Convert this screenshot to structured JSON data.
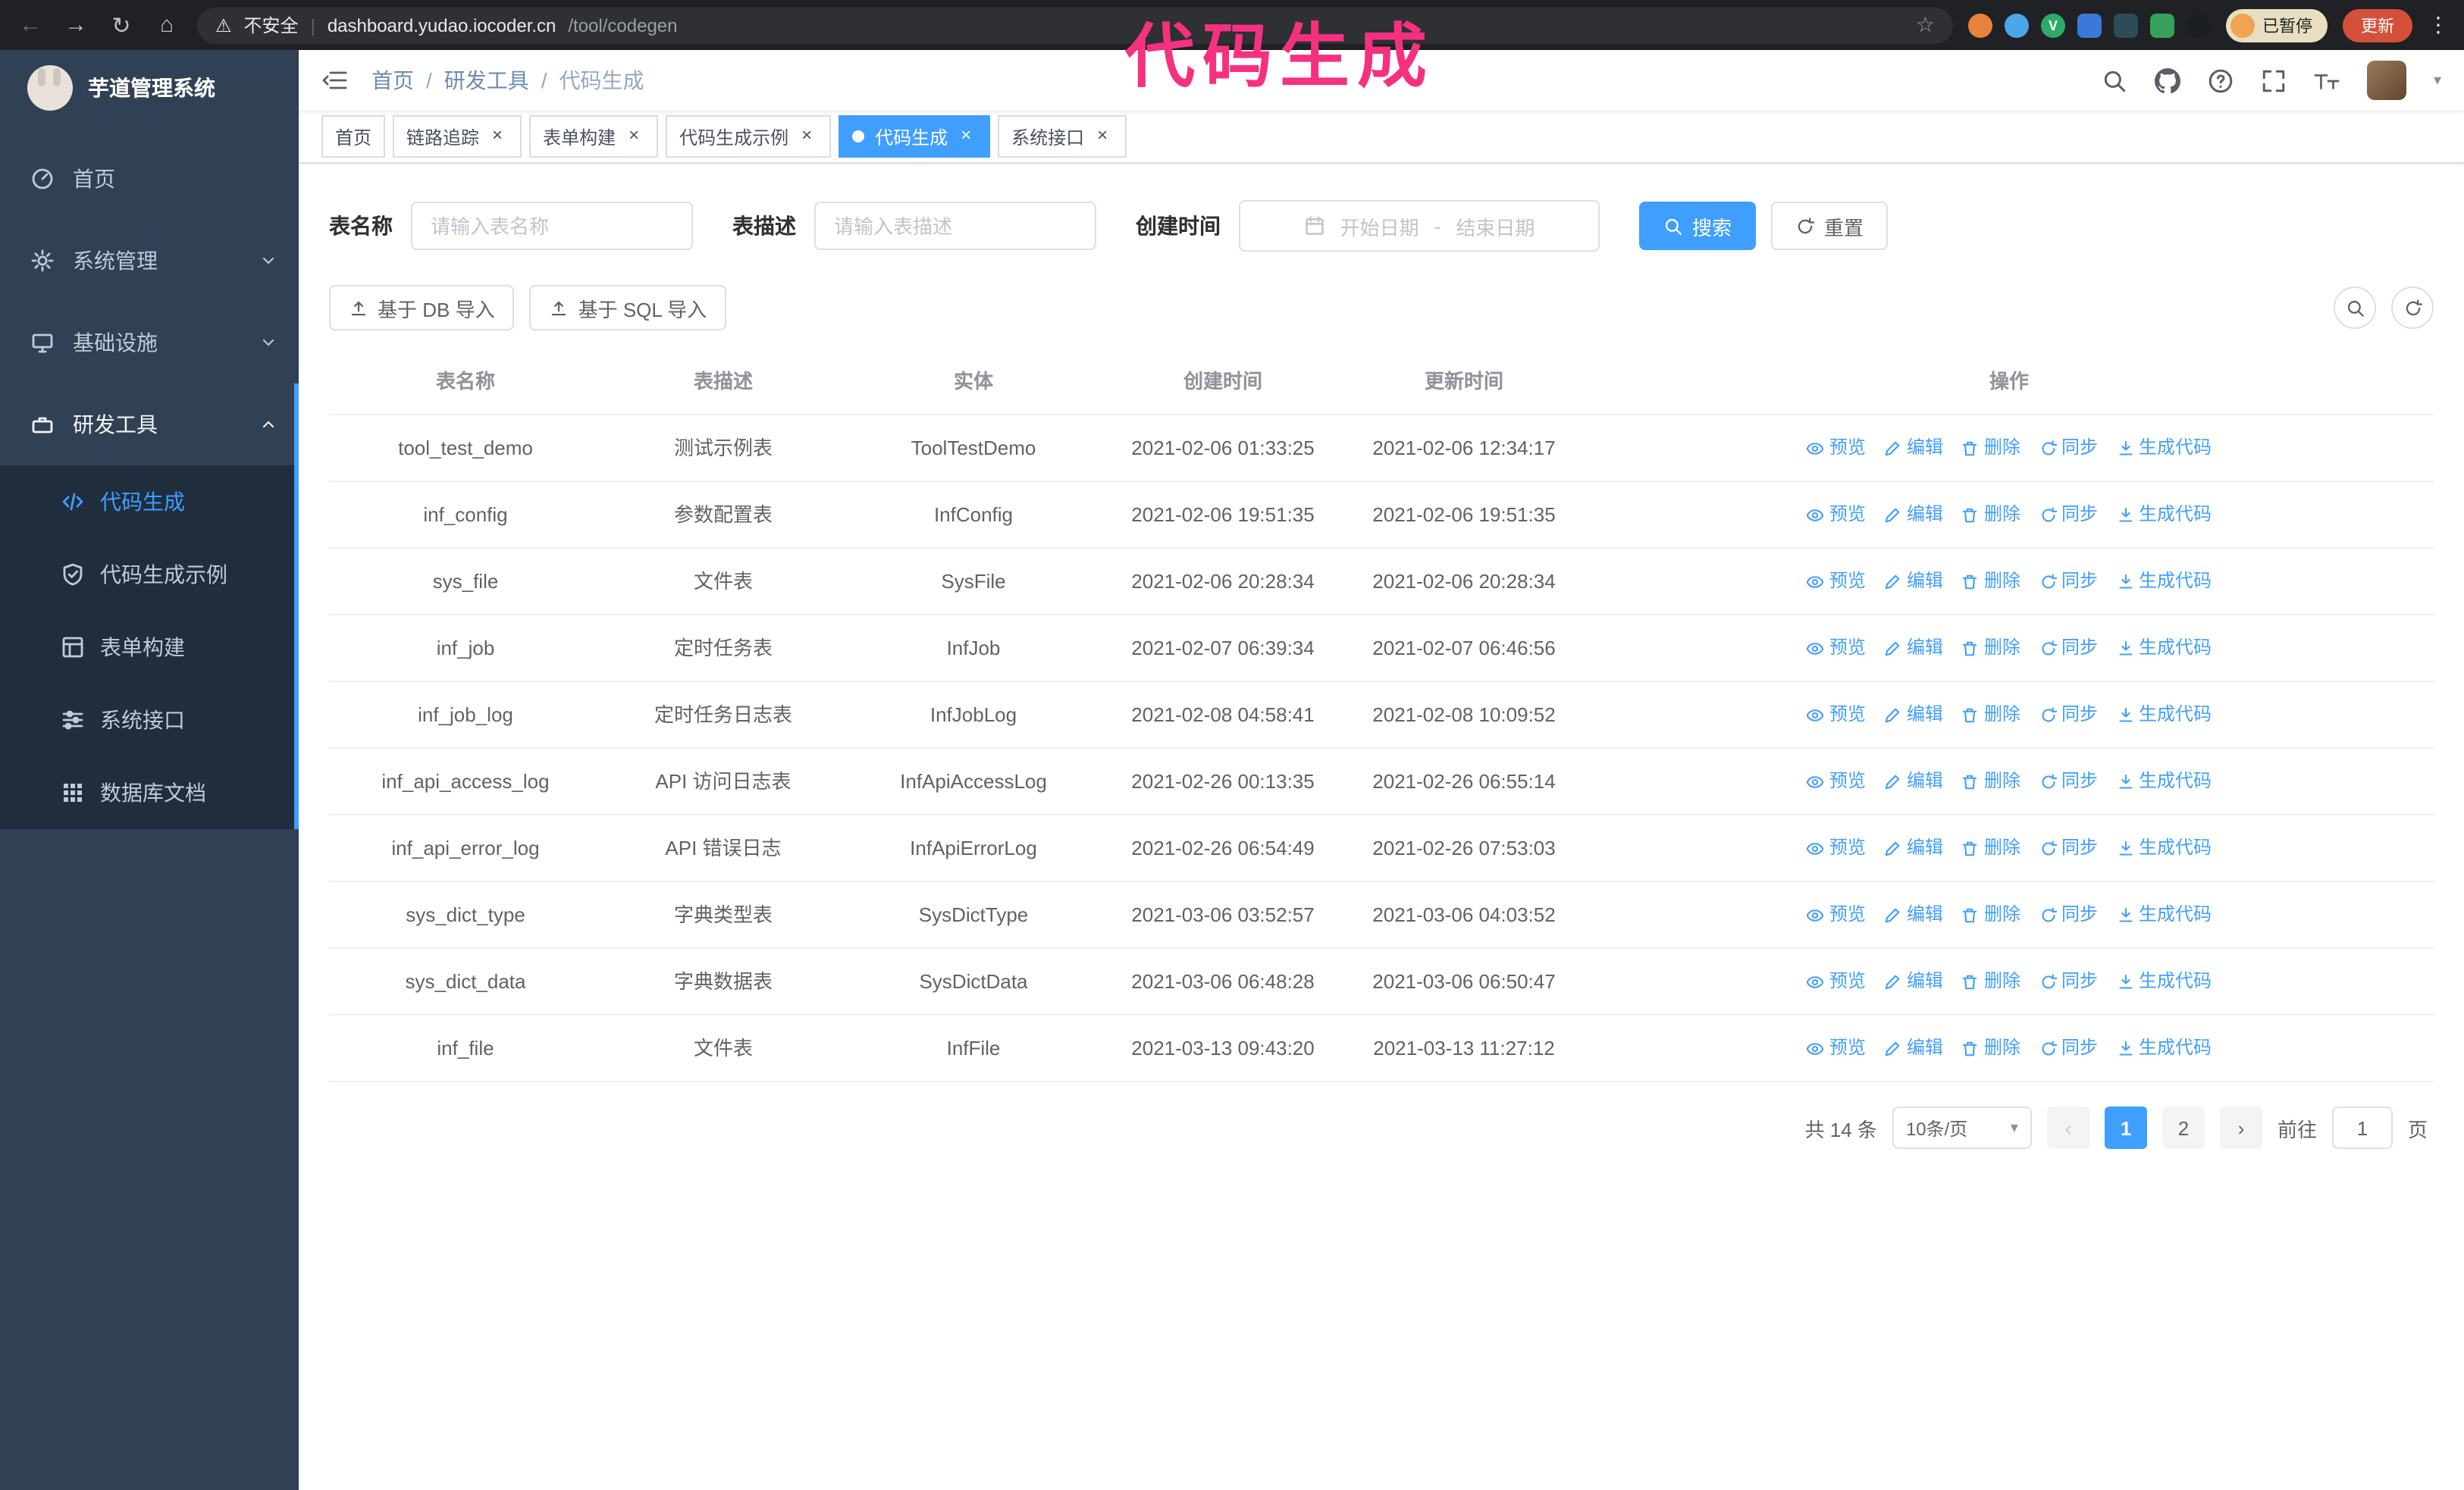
{
  "annotation": {
    "text": "代码生成",
    "color": "#f5317f"
  },
  "browser": {
    "security_label": "不安全",
    "url_host": "dashboard.yudao.iocoder.cn",
    "url_path": "/tool/codegen",
    "profile_badge": "已暂停",
    "update_button": "更新"
  },
  "sidebar": {
    "logo_title": "芋道管理系统",
    "items": [
      {
        "label": "首页"
      },
      {
        "label": "系统管理"
      },
      {
        "label": "基础设施"
      },
      {
        "label": "研发工具"
      }
    ],
    "subitems": [
      {
        "label": "代码生成"
      },
      {
        "label": "代码生成示例"
      },
      {
        "label": "表单构建"
      },
      {
        "label": "系统接口"
      },
      {
        "label": "数据库文档"
      }
    ]
  },
  "header": {
    "breadcrumb": [
      "首页",
      "研发工具",
      "代码生成"
    ]
  },
  "tabs": [
    {
      "label": "首页"
    },
    {
      "label": "链路追踪"
    },
    {
      "label": "表单构建"
    },
    {
      "label": "代码生成示例"
    },
    {
      "label": "代码生成"
    },
    {
      "label": "系统接口"
    }
  ],
  "filters": {
    "table_name_label": "表名称",
    "table_name_placeholder": "请输入表名称",
    "table_desc_label": "表描述",
    "table_desc_placeholder": "请输入表描述",
    "create_time_label": "创建时间",
    "date_start_placeholder": "开始日期",
    "date_separator": "-",
    "date_end_placeholder": "结束日期",
    "search_button": "搜索",
    "reset_button": "重置"
  },
  "toolbar": {
    "import_db_button": "基于 DB 导入",
    "import_sql_button": "基于 SQL 导入"
  },
  "table": {
    "columns": [
      "表名称",
      "表描述",
      "实体",
      "创建时间",
      "更新时间",
      "操作"
    ],
    "row_actions": [
      "预览",
      "编辑",
      "删除",
      "同步",
      "生成代码"
    ],
    "rows": [
      {
        "name": "tool_test_demo",
        "desc": "测试示例表",
        "entity": "ToolTestDemo",
        "created": "2021-02-06 01:33:25",
        "updated": "2021-02-06 12:34:17"
      },
      {
        "name": "inf_config",
        "desc": "参数配置表",
        "entity": "InfConfig",
        "created": "2021-02-06 19:51:35",
        "updated": "2021-02-06 19:51:35"
      },
      {
        "name": "sys_file",
        "desc": "文件表",
        "entity": "SysFile",
        "created": "2021-02-06 20:28:34",
        "updated": "2021-02-06 20:28:34"
      },
      {
        "name": "inf_job",
        "desc": "定时任务表",
        "entity": "InfJob",
        "created": "2021-02-07 06:39:34",
        "updated": "2021-02-07 06:46:56"
      },
      {
        "name": "inf_job_log",
        "desc": "定时任务日志表",
        "entity": "InfJobLog",
        "created": "2021-02-08 04:58:41",
        "updated": "2021-02-08 10:09:52"
      },
      {
        "name": "inf_api_access_log",
        "desc": "API 访问日志表",
        "entity": "InfApiAccessLog",
        "created": "2021-02-26 00:13:35",
        "updated": "2021-02-26 06:55:14"
      },
      {
        "name": "inf_api_error_log",
        "desc": "API 错误日志",
        "entity": "InfApiErrorLog",
        "created": "2021-02-26 06:54:49",
        "updated": "2021-02-26 07:53:03"
      },
      {
        "name": "sys_dict_type",
        "desc": "字典类型表",
        "entity": "SysDictType",
        "created": "2021-03-06 03:52:57",
        "updated": "2021-03-06 04:03:52"
      },
      {
        "name": "sys_dict_data",
        "desc": "字典数据表",
        "entity": "SysDictData",
        "created": "2021-03-06 06:48:28",
        "updated": "2021-03-06 06:50:47"
      },
      {
        "name": "inf_file",
        "desc": "文件表",
        "entity": "InfFile",
        "created": "2021-03-13 09:43:20",
        "updated": "2021-03-13 11:27:12"
      }
    ]
  },
  "pagination": {
    "total_text": "共 14 条",
    "page_size": "10条/页",
    "pages": [
      "1",
      "2"
    ],
    "active_page": "1",
    "goto_label": "前往",
    "goto_value": "1",
    "goto_suffix": "页"
  },
  "icons": {
    "back": "←",
    "forward": "→",
    "reload": "↻",
    "home": "⌂",
    "warning": "⚠",
    "star": "☆",
    "kebab": "⋮",
    "caret_down": "▾",
    "close": "×"
  }
}
